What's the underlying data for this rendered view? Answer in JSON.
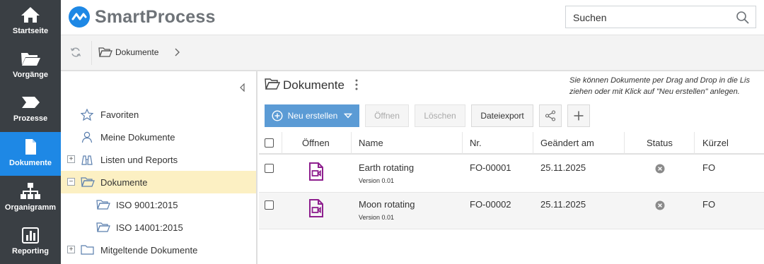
{
  "nav": {
    "items": [
      {
        "label": "Startseite",
        "icon": "home-icon"
      },
      {
        "label": "Vorgänge",
        "icon": "folder-open-icon"
      },
      {
        "label": "Prozesse",
        "icon": "process-arrow-icon"
      },
      {
        "label": "Dokumente",
        "icon": "document-icon",
        "active": true
      },
      {
        "label": "Organigramm",
        "icon": "org-chart-icon"
      },
      {
        "label": "Reporting",
        "icon": "bar-chart-icon"
      }
    ]
  },
  "header": {
    "logo_text": "SmartProcess",
    "search_placeholder": "Suchen"
  },
  "breadcrumb": {
    "current": "Dokumente"
  },
  "tree": {
    "items": [
      {
        "label": "Favoriten",
        "icon": "star-icon"
      },
      {
        "label": "Meine Dokumente",
        "icon": "user-icon"
      },
      {
        "label": "Listen und Reports",
        "icon": "binoculars-icon",
        "expander": "+"
      },
      {
        "label": "Dokumente",
        "icon": "folder-open-icon",
        "expander": "−",
        "selected": true
      },
      {
        "label": "ISO 9001:2015",
        "icon": "folder-open-icon"
      },
      {
        "label": "ISO 14001:2015",
        "icon": "folder-open-icon"
      },
      {
        "label": "Mitgeltende Dokumente",
        "icon": "folder-icon",
        "expander": "+"
      }
    ]
  },
  "main": {
    "title": "Dokumente",
    "hint_line1": "Sie können Dokumente per Drag and Drop in die Lis",
    "hint_line2": "ziehen oder mit Klick auf \"Neu erstellen\" anlegen.",
    "toolbar": {
      "new_label": "Neu erstellen",
      "open_label": "Öffnen",
      "delete_label": "Löschen",
      "export_label": "Dateiexport"
    },
    "columns": {
      "open": "Öffnen",
      "name": "Name",
      "nr": "Nr.",
      "changed": "Geändert am",
      "status": "Status",
      "short": "Kürzel"
    },
    "rows": [
      {
        "name": "Earth rotating",
        "version": "Version 0.01",
        "nr": "FO-00001",
        "changed": "25.11.2025",
        "short": "FO"
      },
      {
        "name": "Moon rotating",
        "version": "Version 0.01",
        "nr": "FO-00002",
        "changed": "25.11.2025",
        "short": "FO"
      }
    ]
  },
  "colors": {
    "nav_bg": "#3a3f44",
    "nav_active": "#1e88e5",
    "primary_button": "#5b9bd5",
    "selected_row": "#fcf0c3",
    "video_file_icon": "#8e1f8e",
    "logo_blue": "#1e88e5"
  }
}
